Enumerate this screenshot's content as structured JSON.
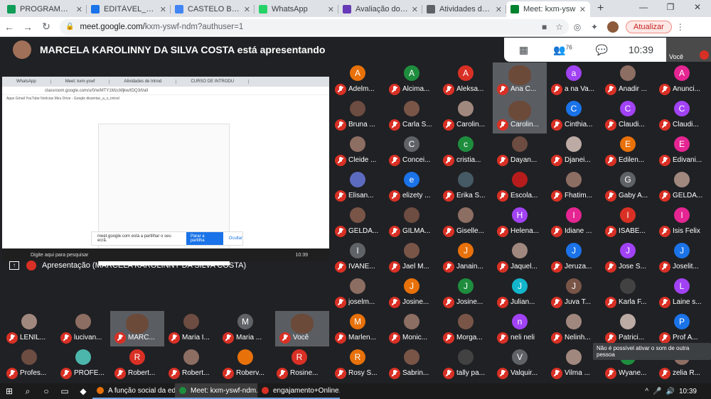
{
  "tabs": [
    {
      "title": "PROGRAMAÇÃO S",
      "color": "#0f9d58",
      "active": false
    },
    {
      "title": "EDITÁVEL_DISSERT",
      "color": "#1a73e8",
      "active": false
    },
    {
      "title": "CASTELO BRANCO",
      "color": "#4285f4",
      "active": false
    },
    {
      "title": "WhatsApp",
      "color": "#25d366",
      "active": false
    },
    {
      "title": "Avaliação do Work",
      "color": "#673ab7",
      "active": false
    },
    {
      "title": "Atividades de Intro",
      "color": "#5f6368",
      "active": false
    },
    {
      "title": "Meet: kxm-ysw",
      "color": "#00832d",
      "active": true
    }
  ],
  "address": {
    "host": "meet.google.com/",
    "path": "kxm-yswf-ndm?authuser=1"
  },
  "update_label": "Atualizar",
  "presenter_banner": "MARCELA KAROLINNY DA SILVA COSTA está apresentando",
  "meet_controls": {
    "participants_count": "76",
    "time": "10:39"
  },
  "self_label": "Você",
  "presentation_caption": "Apresentação (MARCELA KAROLINNY DA SILVA COSTA)",
  "shared_screen": {
    "inner_tabs": [
      "WhatsApp",
      "Meet: kxm-yswf",
      "Atividades de Introd",
      "CURSO DE INTRODU"
    ],
    "inner_url": "classroom.google.com/u/0/w/MTY1MzcMjkw/tDQ3/t/all",
    "bookmarks": "Apps   Gmail   YouTube   Notícias   Meu Drive - Google   dissertac_a_o_introd",
    "notif_text": "meet.google.com está a partilhar o seu ecrã.",
    "notif_button": "Parar a partilha",
    "notif_hide": "Ocultar",
    "inner_search": "Digite aqui para pesquisar",
    "inner_time": "10:39"
  },
  "participants": [
    {
      "name": "Adelm...",
      "initial": "A",
      "color": "#e8710a"
    },
    {
      "name": "Alcima...",
      "initial": "A",
      "color": "#1e8e3e"
    },
    {
      "name": "Aleksa...",
      "initial": "A",
      "color": "#d93025"
    },
    {
      "name": "Ana C...",
      "initial": "",
      "color": "#5f6368",
      "video": true
    },
    {
      "name": "a na Va...",
      "initial": "a",
      "color": "#a142f4"
    },
    {
      "name": "Anadir ...",
      "initial": "",
      "color": "#8d6e63"
    },
    {
      "name": "Anunci...",
      "initial": "A",
      "color": "#e52592"
    },
    {
      "name": "Bruna ...",
      "initial": "",
      "color": "#6d4c41"
    },
    {
      "name": "Carla S...",
      "initial": "",
      "color": "#795548"
    },
    {
      "name": "Carolin...",
      "initial": "",
      "color": "#a1887f"
    },
    {
      "name": "Carolin...",
      "initial": "",
      "color": "#5f6368",
      "video": true
    },
    {
      "name": "Cinthia...",
      "initial": "C",
      "color": "#1a73e8"
    },
    {
      "name": "Claudi...",
      "initial": "C",
      "color": "#a142f4"
    },
    {
      "name": "Claudi...",
      "initial": "C",
      "color": "#a142f4"
    },
    {
      "name": "Cleide ...",
      "initial": "",
      "color": "#8d6e63"
    },
    {
      "name": "Concei...",
      "initial": "C",
      "color": "#5f6368"
    },
    {
      "name": "cristia...",
      "initial": "c",
      "color": "#1e8e3e"
    },
    {
      "name": "Dayan...",
      "initial": "",
      "color": "#6d4c41"
    },
    {
      "name": "Djanei...",
      "initial": "",
      "color": "#bcaaa4"
    },
    {
      "name": "Edilen...",
      "initial": "E",
      "color": "#e8710a"
    },
    {
      "name": "Edivani...",
      "initial": "E",
      "color": "#e52592"
    },
    {
      "name": "Elisan...",
      "initial": "",
      "color": "#5c6bc0"
    },
    {
      "name": "elizety ...",
      "initial": "e",
      "color": "#1a73e8"
    },
    {
      "name": "Erika S...",
      "initial": "",
      "color": "#455a64"
    },
    {
      "name": "Escola...",
      "initial": "",
      "color": "#b71c1c"
    },
    {
      "name": "Fhatim...",
      "initial": "",
      "color": "#8d6e63"
    },
    {
      "name": "Gaby A...",
      "initial": "G",
      "color": "#5f6368"
    },
    {
      "name": "GELDA...",
      "initial": "",
      "color": "#a1887f"
    },
    {
      "name": "GELDA...",
      "initial": "",
      "color": "#795548"
    },
    {
      "name": "GILMA...",
      "initial": "",
      "color": "#6d4c41"
    },
    {
      "name": "Giselle...",
      "initial": "",
      "color": "#8d6e63"
    },
    {
      "name": "Helena...",
      "initial": "H",
      "color": "#a142f4"
    },
    {
      "name": "Idiane ...",
      "initial": "I",
      "color": "#e52592"
    },
    {
      "name": "ISABE...",
      "initial": "I",
      "color": "#d93025"
    },
    {
      "name": "Isis Felix",
      "initial": "I",
      "color": "#e52592"
    },
    {
      "name": "IVANE...",
      "initial": "I",
      "color": "#5f6368"
    },
    {
      "name": "Jael M...",
      "initial": "",
      "color": "#795548"
    },
    {
      "name": "Janain...",
      "initial": "J",
      "color": "#e8710a"
    },
    {
      "name": "Jaquel...",
      "initial": "",
      "color": "#a1887f"
    },
    {
      "name": "Jeruza...",
      "initial": "J",
      "color": "#1a73e8"
    },
    {
      "name": "Jose S...",
      "initial": "J",
      "color": "#a142f4"
    },
    {
      "name": "Joselit...",
      "initial": "J",
      "color": "#1a73e8"
    },
    {
      "name": "joselm...",
      "initial": "",
      "color": "#8d6e63"
    },
    {
      "name": "Josine...",
      "initial": "J",
      "color": "#e8710a"
    },
    {
      "name": "Josine...",
      "initial": "J",
      "color": "#1e8e3e"
    },
    {
      "name": "Julian...",
      "initial": "J",
      "color": "#12b5cb"
    },
    {
      "name": "Juva T...",
      "initial": "J",
      "color": "#795548"
    },
    {
      "name": "Karla F...",
      "initial": "",
      "color": "#424242"
    },
    {
      "name": "Laine s...",
      "initial": "L",
      "color": "#a142f4"
    },
    {
      "name": "LENIL...",
      "initial": "",
      "color": "#a1887f"
    },
    {
      "name": "lucivan...",
      "initial": "",
      "color": "#8d6e63"
    },
    {
      "name": "MARC...",
      "initial": "",
      "color": "#5f6368",
      "video": true
    },
    {
      "name": "Maria I...",
      "initial": "",
      "color": "#6d4c41"
    },
    {
      "name": "Maria ...",
      "initial": "M",
      "color": "#5f6368"
    },
    {
      "name": "Marlen...",
      "initial": "M",
      "color": "#e8710a"
    },
    {
      "name": "Monic...",
      "initial": "",
      "color": "#8d6e63"
    },
    {
      "name": "Morga...",
      "initial": "",
      "color": "#795548"
    },
    {
      "name": "neli neli",
      "initial": "n",
      "color": "#a142f4"
    },
    {
      "name": "Nelinh...",
      "initial": "",
      "color": "#a1887f"
    },
    {
      "name": "Patrici...",
      "initial": "",
      "color": "#bcaaa4"
    },
    {
      "name": "Prof A...",
      "initial": "P",
      "color": "#1a73e8"
    },
    {
      "name": "Profes...",
      "initial": "",
      "color": "#6d4c41"
    },
    {
      "name": "PROFE...",
      "initial": "",
      "color": "#4db6ac"
    },
    {
      "name": "Robert...",
      "initial": "R",
      "color": "#d93025"
    },
    {
      "name": "Robert...",
      "initial": "",
      "color": "#8d6e63"
    },
    {
      "name": "Roberv...",
      "initial": "",
      "color": "#e8710a"
    },
    {
      "name": "Rosine...",
      "initial": "R",
      "color": "#d93025"
    },
    {
      "name": "Rosy S...",
      "initial": "R",
      "color": "#e8710a"
    },
    {
      "name": "Sabrin...",
      "initial": "",
      "color": "#795548"
    },
    {
      "name": "tally pa...",
      "initial": "",
      "color": "#424242"
    },
    {
      "name": "Valquir...",
      "initial": "V",
      "color": "#5f6368"
    },
    {
      "name": "Vilma ...",
      "initial": "",
      "color": "#a1887f"
    },
    {
      "name": "Wyane...",
      "initial": "W",
      "color": "#1e8e3e"
    },
    {
      "name": "zelia R...",
      "initial": "",
      "color": "#8d6e63"
    }
  ],
  "self_tile_label": "Você",
  "tooltip": "Não é possível ativar o som de outra pessoa",
  "taskbar": {
    "apps": [
      {
        "title": "A função social da ed...",
        "color": "#e8710a",
        "selected": false
      },
      {
        "title": "Meet: kxm-yswf-ndm...",
        "color": "#1e8e3e",
        "selected": true
      },
      {
        "title": "engajamento+Online...",
        "color": "#d93025",
        "selected": false
      }
    ],
    "time": "10:39"
  }
}
